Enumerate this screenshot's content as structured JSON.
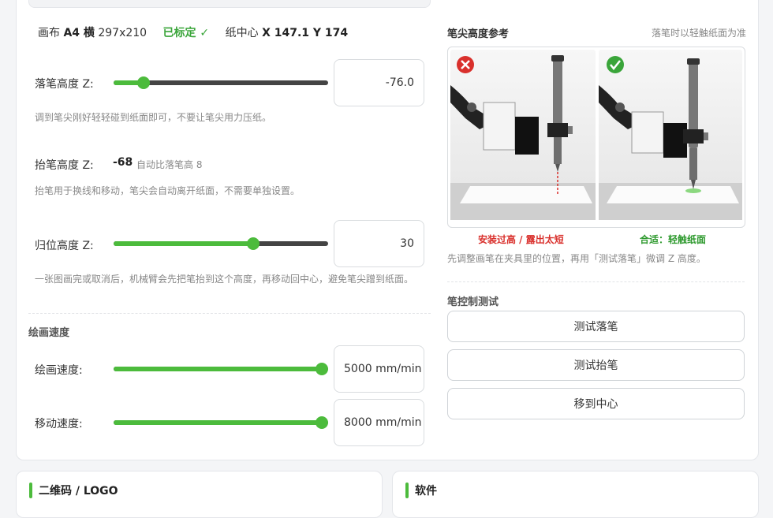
{
  "status": {
    "canvas_prefix": "画布",
    "canvas_size": "A4 横",
    "canvas_dims": "297x210",
    "calibrated": "已标定 ✓",
    "center_prefix": "纸中心",
    "center_value": "X 147.1 Y 174"
  },
  "pen_down": {
    "label": "落笔高度 Z:",
    "value": "-76.0",
    "level_fraction": 0.14,
    "hint": "调到笔尖刚好轻轻碰到纸面即可，不要让笔尖用力压纸。"
  },
  "pen_up": {
    "label": "抬笔高度 Z:",
    "value": "-68",
    "note": "自动比落笔高 8",
    "hint": "抬笔用于换线和移动，笔尖会自动离开纸面，不需要单独设置。"
  },
  "home": {
    "label": "归位高度 Z:",
    "value": "30",
    "level_fraction": 0.65,
    "hint": "一张图画完或取消后，机械臂会先把笔抬到这个高度，再移动回中心，避免笔尖蹭到纸面。"
  },
  "speed": {
    "section_title": "绘画速度",
    "draw_label": "绘画速度:",
    "draw_value": "5000 mm/min",
    "draw_level": 1.0,
    "move_label": "移动速度:",
    "move_value": "8000 mm/min",
    "move_level": 1.0
  },
  "reference": {
    "title": "笔尖高度参考",
    "subtitle": "落笔时以轻触纸面为准",
    "bad_caption": "安装过高 / 露出太短",
    "good_caption": "合适：轻触纸面",
    "hint": "先调整画笔在夹具里的位置，再用「测试落笔」微调 Z 高度。"
  },
  "pen_test": {
    "title": "笔控制测试",
    "buttons": [
      "测试落笔",
      "测试抬笔",
      "移到中心"
    ]
  },
  "bottom": {
    "left_title": "二维码 / LOGO",
    "right_title": "软件"
  },
  "colors": {
    "accent": "#4cbb3c",
    "bad": "#d9302c",
    "good": "#2f9a2f"
  }
}
